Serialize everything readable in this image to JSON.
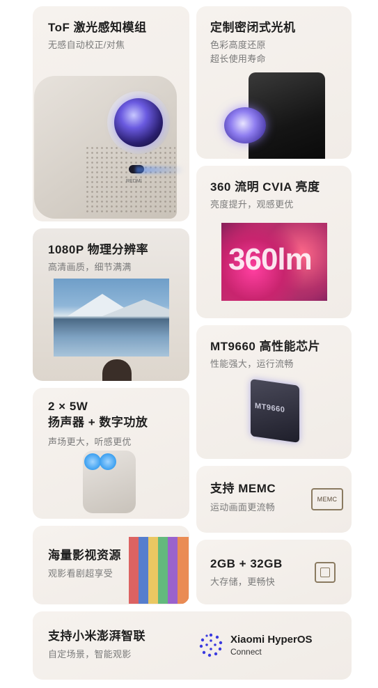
{
  "cards": {
    "tof": {
      "title": "ToF 激光感知模组",
      "sub": "无感自动校正/对焦",
      "brand": "REDMI"
    },
    "sealed": {
      "title": "定制密闭式光机",
      "sub1": "色彩高度还原",
      "sub2": "超长使用寿命"
    },
    "brightness": {
      "title": "360 流明 CVIA 亮度",
      "sub": "亮度提升，观感更优",
      "screen_text": "360lm"
    },
    "resolution": {
      "title": "1080P 物理分辨率",
      "sub": "高清画质，细节满满"
    },
    "chip": {
      "title": "MT9660 高性能芯片",
      "sub": "性能强大，运行流畅",
      "chip_label": "MT9660"
    },
    "speaker": {
      "title_line1": "2 × 5W",
      "title_line2": "扬声器 + 数字功放",
      "sub": "声场更大，听感更优"
    },
    "memc": {
      "title": "支持 MEMC",
      "sub": "运动画面更流畅",
      "badge": "MEMC"
    },
    "media": {
      "title": "海量影视资源",
      "sub": "观影看剧超享受"
    },
    "storage": {
      "title": "2GB + 32GB",
      "sub": "大存储，更畅快"
    },
    "hyperos": {
      "title": "支持小米澎湃智联",
      "sub": "自定场景，智能观影",
      "logo_line1": "Xiaomi HyperOS",
      "logo_line2": "Connect"
    }
  },
  "colors": {
    "card_bg": "#f4f0ec",
    "title": "#1e1e1e",
    "subtitle": "#7a7a7a",
    "accent_lens": "#6a5ae0",
    "hyperos_dots": "#3a3adf"
  },
  "icons": [
    "memc-badge-icon",
    "chip-icon",
    "hyperos-logo-icon"
  ]
}
